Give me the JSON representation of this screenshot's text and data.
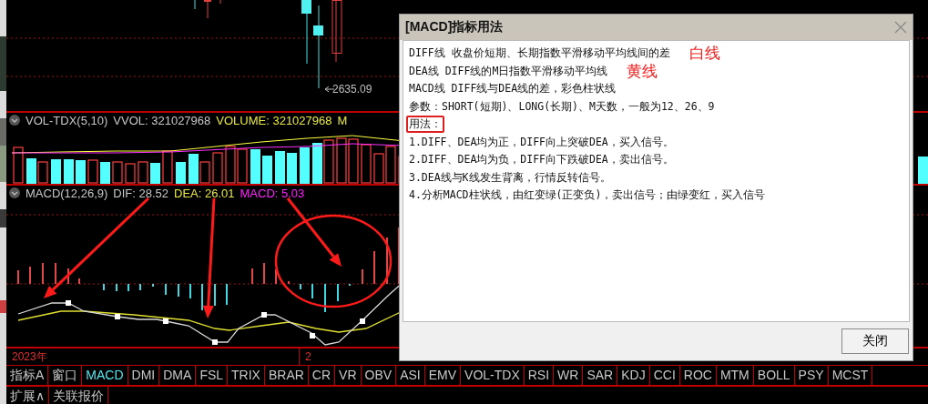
{
  "price_pane": {
    "low_label": "2635.09"
  },
  "volume_panel": {
    "indicator": "VOL-TDX(5,10)",
    "vvol": "VVOL: 321027968",
    "volume": "VOLUME: 321027968",
    "cut_label": "M"
  },
  "macd_panel": {
    "indicator": "MACD(12,26,9)",
    "dif": "DIF: 28.52",
    "dea": "DEA: 26.01",
    "macd": "MACD: 5.03"
  },
  "date_row": [
    "2023年",
    "2"
  ],
  "indicator_tabs": [
    {
      "label": "指标A",
      "selected": false
    },
    {
      "label": "窗口",
      "selected": false
    },
    {
      "label": "MACD",
      "selected": true
    },
    {
      "label": "DMI",
      "selected": false
    },
    {
      "label": "DMA",
      "selected": false
    },
    {
      "label": "FSL",
      "selected": false
    },
    {
      "label": "TRIX",
      "selected": false
    },
    {
      "label": "BRAR",
      "selected": false
    },
    {
      "label": "CR",
      "selected": false
    },
    {
      "label": "VR",
      "selected": false
    },
    {
      "label": "OBV",
      "selected": false
    },
    {
      "label": "ASI",
      "selected": false
    },
    {
      "label": "EMV",
      "selected": false
    },
    {
      "label": "VOL-TDX",
      "selected": false
    },
    {
      "label": "RSI",
      "selected": false
    },
    {
      "label": "WR",
      "selected": false
    },
    {
      "label": "SAR",
      "selected": false
    },
    {
      "label": "KDJ",
      "selected": false
    },
    {
      "label": "CCI",
      "selected": false
    },
    {
      "label": "ROC",
      "selected": false
    },
    {
      "label": "MTM",
      "selected": false
    },
    {
      "label": "BOLL",
      "selected": false
    },
    {
      "label": "PSY",
      "selected": false
    },
    {
      "label": "MCST",
      "selected": false
    }
  ],
  "extra_bar": [
    "扩展∧",
    "关联报价"
  ],
  "dialog": {
    "title": "[MACD]指标用法",
    "button": "关闭",
    "lines": [
      {
        "text": "DIFF线  收盘价短期、长期指数平滑移动平均线间的差",
        "note": "白线",
        "boxed": false
      },
      {
        "text": "DEA线  DIFF线的M日指数平滑移动平均线",
        "note": "黄线",
        "boxed": false
      },
      {
        "text": "MACD线  DIFF线与DEA线的差，彩色柱状线",
        "boxed": false
      },
      {
        "text": "参数：SHORT(短期)、LONG(长期)、M天数，一般为12、26、9",
        "boxed": false
      },
      {
        "text": "用法：",
        "boxed": true
      },
      {
        "text": "1.DIFF、DEA均为正，DIFF向上突破DEA，买入信号。",
        "boxed": false
      },
      {
        "text": "2.DIFF、DEA均为负，DIFF向下跌破DEA，卖出信号。",
        "boxed": false
      },
      {
        "text": "3.DEA线与K线发生背离，行情反转信号。",
        "boxed": false
      },
      {
        "text": "4.分析MACD柱状线，由红变绿(正变负)，卖出信号；由绿变红，买入信号",
        "boxed": false
      }
    ]
  }
}
